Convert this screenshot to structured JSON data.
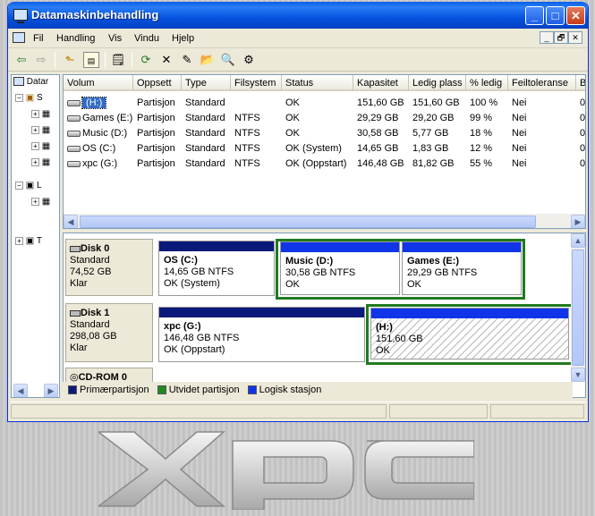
{
  "window": {
    "title": "Datamaskinbehandling"
  },
  "titlebar_buttons": {
    "min": "_",
    "max": "□",
    "close": "✕"
  },
  "menu": [
    "Fil",
    "Handling",
    "Vis",
    "Vindu",
    "Hjelp"
  ],
  "mdi_buttons": [
    "_",
    "🗗",
    "✕"
  ],
  "toolbar": [
    "back-icon",
    "forward-icon",
    "up-folder-icon",
    "show-hide-tree-icon",
    "properties-icon",
    "refresh-icon",
    "delete-icon",
    "edit-icon",
    "open-icon",
    "search-icon",
    "settings-icon"
  ],
  "tree": {
    "root": "Datar",
    "n1": "S",
    "n2": "L",
    "n3": "T"
  },
  "table": {
    "headers": [
      "Volum",
      "Oppsett",
      "Type",
      "Filsystem",
      "Status",
      "Kapasitet",
      "Ledig plass",
      "% ledig",
      "Feiltoleranse",
      "Be"
    ],
    "rows": [
      [
        "(H:)",
        "Partisjon",
        "Standard",
        "",
        "OK",
        "151,60 GB",
        "151,60 GB",
        "100 %",
        "Nei",
        "0"
      ],
      [
        "Games (E:)",
        "Partisjon",
        "Standard",
        "NTFS",
        "OK",
        "29,29 GB",
        "29,20 GB",
        "99 %",
        "Nei",
        "0"
      ],
      [
        "Music (D:)",
        "Partisjon",
        "Standard",
        "NTFS",
        "OK",
        "30,58 GB",
        "5,77 GB",
        "18 %",
        "Nei",
        "0"
      ],
      [
        "OS (C:)",
        "Partisjon",
        "Standard",
        "NTFS",
        "OK (System)",
        "14,65 GB",
        "1,83 GB",
        "12 %",
        "Nei",
        "0"
      ],
      [
        "xpc (G:)",
        "Partisjon",
        "Standard",
        "NTFS",
        "OK (Oppstart)",
        "146,48 GB",
        "81,82 GB",
        "55 %",
        "Nei",
        "0"
      ]
    ]
  },
  "disks": {
    "disk0": {
      "name": "Disk 0",
      "type": "Standard",
      "size": "74,52 GB",
      "state": "Klar"
    },
    "disk1": {
      "name": "Disk 1",
      "type": "Standard",
      "size": "298,08 GB",
      "state": "Klar"
    },
    "cdrom": {
      "name": "CD-ROM 0"
    }
  },
  "partitions": {
    "os": {
      "name": "OS  (C:)",
      "size": "14,65 GB NTFS",
      "status": "OK (System)"
    },
    "music": {
      "name": "Music  (D:)",
      "size": "30,58 GB NTFS",
      "status": "OK"
    },
    "games": {
      "name": "Games  (E:)",
      "size": "29,29 GB NTFS",
      "status": "OK"
    },
    "xpc": {
      "name": "xpc  (G:)",
      "size": "146,48 GB NTFS",
      "status": "OK (Oppstart)"
    },
    "h": {
      "name": "(H:)",
      "size": "151,60 GB",
      "status": "OK"
    }
  },
  "legend": [
    "Primærpartisjon",
    "Utvidet partisjon",
    "Logisk stasjon"
  ],
  "colors": {
    "primary": "#0b1a7a",
    "extended": "#1f8a1f",
    "logical": "#1035e8"
  },
  "logo_text": "xpc"
}
